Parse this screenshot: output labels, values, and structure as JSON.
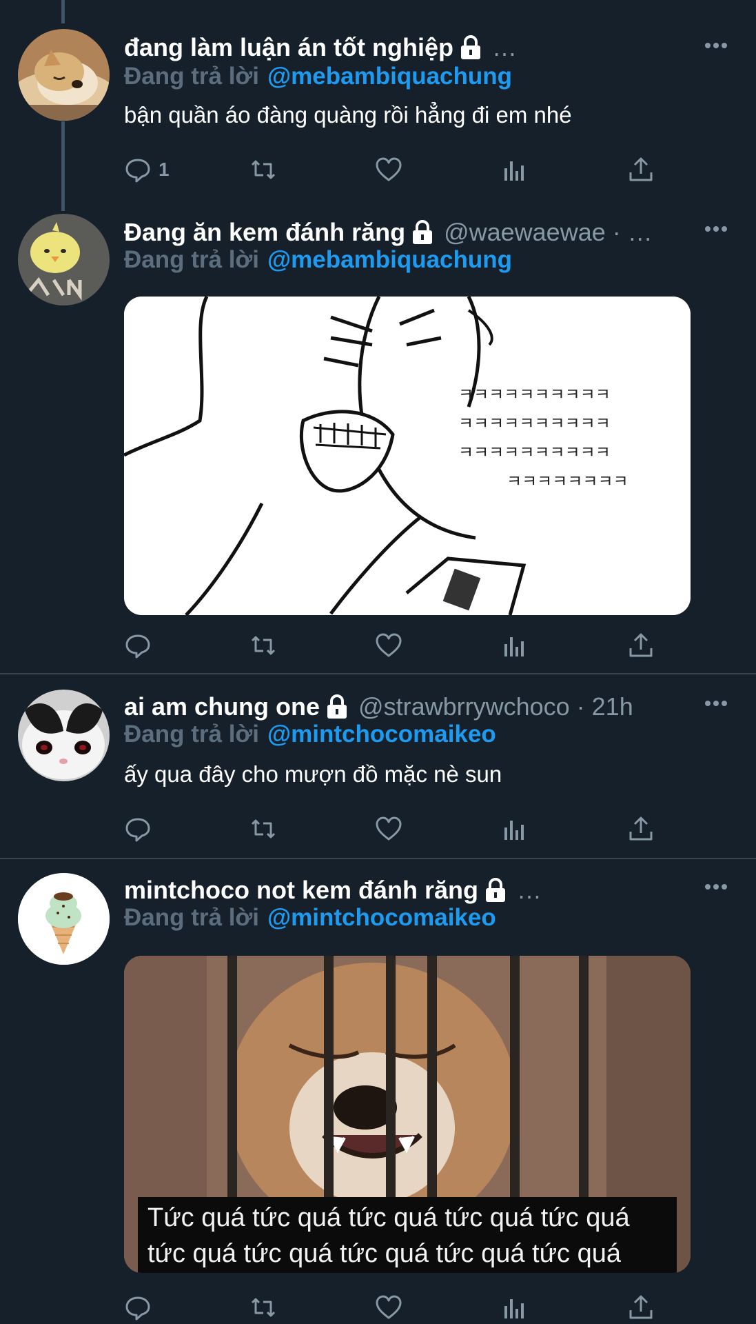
{
  "theme": {
    "background": "#15202b",
    "divider": "#38444d",
    "accent": "#1d9bf0",
    "muted": "#8899a6"
  },
  "tweets": [
    {
      "display_name": "đang làm luận án tốt nghiệp",
      "handle_meta": "…",
      "reply_prefix": "Đang trả lời",
      "reply_handle": "@mebambiquachung",
      "text": "bận quần áo đàng quàng rồi hẳng đi em nhé",
      "reply_count": "1",
      "avatar": "shiba-dog-avatar",
      "protected_icon": "lock-icon"
    },
    {
      "display_name": "Đang ăn kem đánh răng",
      "handle_meta": "@waewaewae · …",
      "reply_prefix": "Đang trả lời",
      "reply_handle": "@mebambiquachung",
      "media": "laughing-meme-image",
      "media_text": [
        "ㅋㅋㅋㅋㅋㅋㅋㅋㅋㅋ",
        "ㅋㅋㅋㅋㅋㅋㅋㅋㅋㅋ",
        "ㅋㅋㅋㅋㅋㅋㅋㅋㅋㅋ",
        "ㅋㅋㅋㅋㅋㅋㅋㅋ"
      ],
      "avatar": "duckling-avatar",
      "protected_icon": "lock-icon"
    },
    {
      "display_name": "ai am chung one",
      "handle_meta": "@strawbrrywchoco · 21h",
      "reply_prefix": "Đang trả lời",
      "reply_handle": "@mintchocomaikeo",
      "text": "ấy qua đây cho mượn đồ mặc nè sun",
      "avatar": "cat-avatar",
      "protected_icon": "lock-icon"
    },
    {
      "display_name": "mintchoco not kem đánh răng",
      "handle_meta": "…",
      "reply_prefix": "Đang trả lời",
      "reply_handle": "@mintchocomaikeo",
      "media": "angry-shiba-meme-image",
      "media_caption_line1": "Tức quá tức quá tức quá tức quá tức quá",
      "media_caption_line2": "tức quá tức quá tức quá tức quá tức quá",
      "avatar": "ice-cream-avatar",
      "protected_icon": "lock-icon"
    }
  ],
  "action_icons": [
    "reply-icon",
    "retweet-icon",
    "like-icon",
    "analytics-icon",
    "share-icon"
  ]
}
